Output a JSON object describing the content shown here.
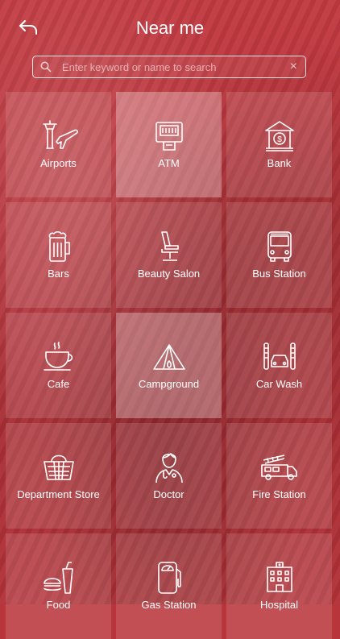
{
  "header": {
    "title": "Near me",
    "back_icon": "back-arrow-icon"
  },
  "search": {
    "placeholder": "Enter keyword or name to search",
    "value": "",
    "clear_label": "×"
  },
  "categories": [
    {
      "label": "Airports",
      "icon": "airport-icon"
    },
    {
      "label": "ATM",
      "icon": "atm-icon"
    },
    {
      "label": "Bank",
      "icon": "bank-icon"
    },
    {
      "label": "Bars",
      "icon": "beer-mug-icon"
    },
    {
      "label": "Beauty Salon",
      "icon": "salon-chair-icon"
    },
    {
      "label": "Bus Station",
      "icon": "bus-icon"
    },
    {
      "label": "Cafe",
      "icon": "coffee-cup-icon"
    },
    {
      "label": "Campground",
      "icon": "tent-icon"
    },
    {
      "label": "Car Wash",
      "icon": "car-wash-icon"
    },
    {
      "label": "Department Store",
      "icon": "basket-icon"
    },
    {
      "label": "Doctor",
      "icon": "doctor-icon"
    },
    {
      "label": "Fire Station",
      "icon": "fire-truck-icon"
    },
    {
      "label": "Food",
      "icon": "food-icon"
    },
    {
      "label": "Gas Station",
      "icon": "gas-pump-icon"
    },
    {
      "label": "Hospital",
      "icon": "hospital-icon"
    }
  ],
  "colors": {
    "background": "#b8353b",
    "text": "#ffffff"
  }
}
